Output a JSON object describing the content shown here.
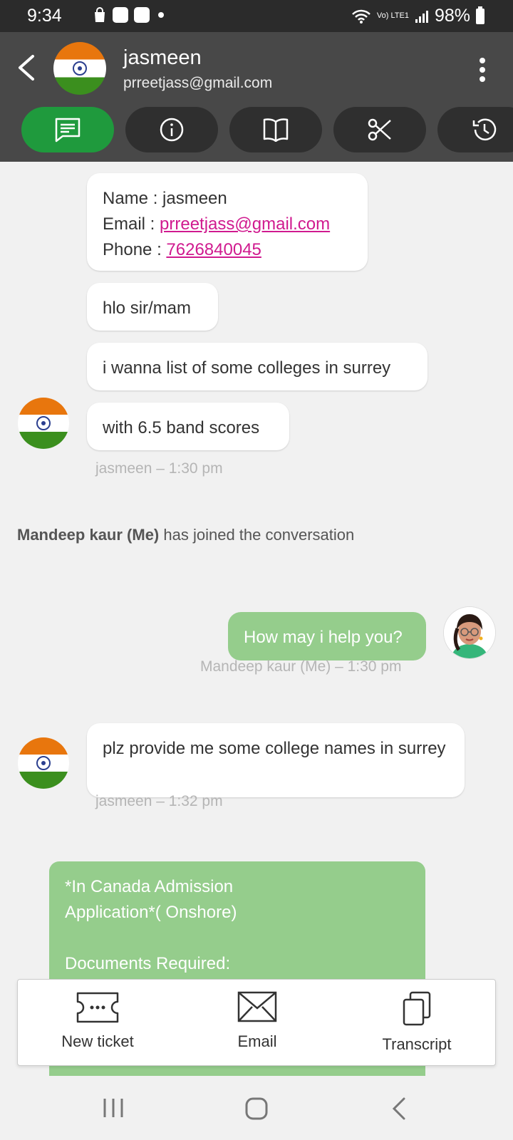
{
  "status_bar": {
    "time": "9:34",
    "network_label": "Vo) LTE1",
    "battery": "98%"
  },
  "header": {
    "contact_name": "jasmeen",
    "contact_email": "prreetjass@gmail.com",
    "tabs": [
      "chat-icon",
      "info-icon",
      "book-icon",
      "scissors-icon",
      "history-icon"
    ],
    "active_tab_color": "#1f9a3d"
  },
  "chat": {
    "info_card": {
      "name_label": "Name : ",
      "name_value": "jasmeen",
      "email_label": "Email : ",
      "email_value": "prreetjass@gmail.com",
      "phone_label": "Phone : ",
      "phone_value": "7626840045"
    },
    "messages": [
      {
        "text": "hlo sir/mam"
      },
      {
        "text": "i wanna list of some colleges in surrey"
      },
      {
        "text": "with 6.5 band scores"
      },
      {
        "text": "How may i help you?"
      },
      {
        "text": "plz provide me some college names in surrey"
      }
    ],
    "meta_1": "jasmeen – 1:30 pm",
    "join_name": "Mandeep kaur (Me)",
    "join_text": " has joined the conversation",
    "meta_2": "Mandeep kaur (Me) – 1:30 pm",
    "meta_3": "jasmeen – 1:32 pm",
    "template_line1": "*In Canada Admission",
    "template_line2": "Application*( Onshore)",
    "template_line3": "Documents Required:"
  },
  "actions": {
    "new_ticket": "New ticket",
    "email": "Email",
    "transcript": "Transcript"
  }
}
